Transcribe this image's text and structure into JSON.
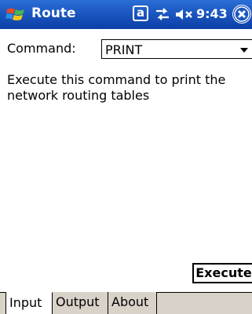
{
  "titlebar": {
    "app_title": "Route",
    "status_a": "a",
    "clock": "9:43",
    "icons": {
      "start": "windows-start-icon",
      "connectivity": "connectivity-icon",
      "volume": "volume-muted-icon",
      "close": "close-icon"
    }
  },
  "form": {
    "command_label": "Command:",
    "command_value": "PRINT"
  },
  "description": "Execute this command to print the\nnetwork routing tables",
  "execute_label": "Execute",
  "tabs": [
    {
      "label": "Input",
      "active": true
    },
    {
      "label": "Output",
      "active": false
    },
    {
      "label": "About",
      "active": false
    }
  ],
  "colors": {
    "titlebar_blue": "#1b57c0",
    "tabbar_bg": "#d9d2c9"
  }
}
